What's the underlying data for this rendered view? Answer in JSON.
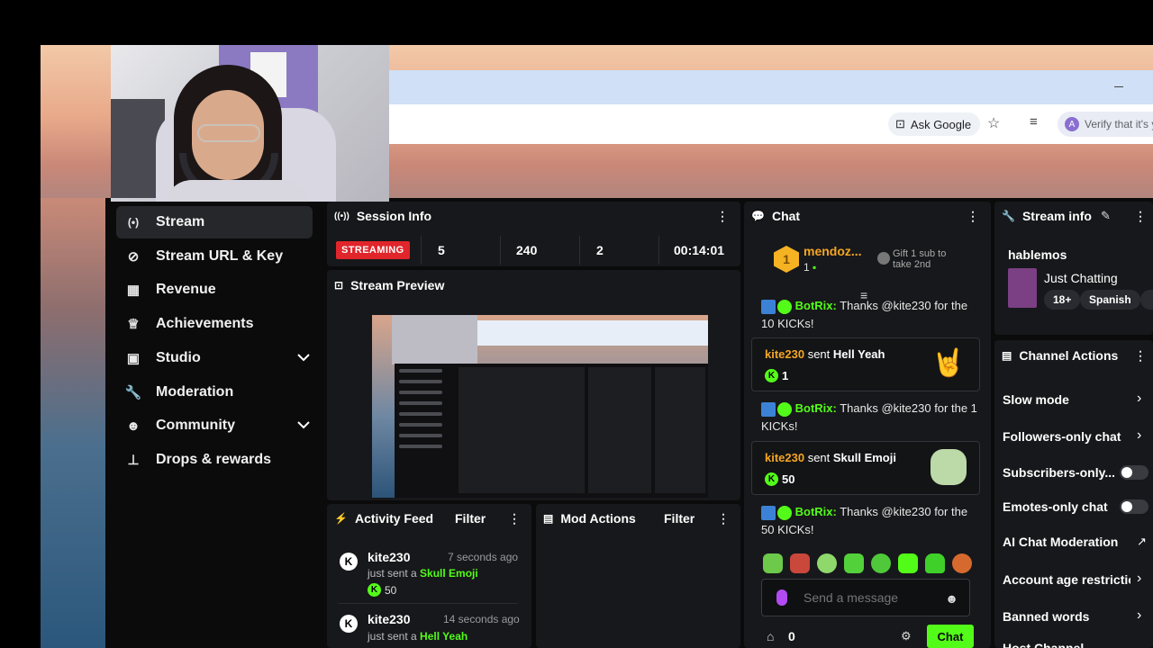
{
  "browser": {
    "ask_google": "Ask Google",
    "verify_text": "Verify that it's y",
    "verify_avatar": "A"
  },
  "sidebar": {
    "items": [
      {
        "label": "Stream",
        "icon": "broadcast-icon",
        "glyph": "(•)"
      },
      {
        "label": "Stream URL & Key",
        "icon": "link-icon",
        "glyph": "🔗"
      },
      {
        "label": "Revenue",
        "icon": "chart-icon",
        "glyph": "▦"
      },
      {
        "label": "Achievements",
        "icon": "trophy-icon",
        "glyph": "🏆"
      },
      {
        "label": "Studio",
        "icon": "studio-icon",
        "glyph": "▣"
      },
      {
        "label": "Moderation",
        "icon": "wrench-icon",
        "glyph": "🔧"
      },
      {
        "label": "Community",
        "icon": "users-icon",
        "glyph": "👥"
      },
      {
        "label": "Drops & rewards",
        "icon": "drops-icon",
        "glyph": "⏇"
      }
    ]
  },
  "session_info": {
    "title": "Session Info",
    "status": "STREAMING",
    "viewers": "5",
    "followers": "240",
    "subs": "2",
    "uptime": "00:14:01"
  },
  "stream_preview": {
    "title": "Stream Preview"
  },
  "activity_feed": {
    "title": "Activity Feed",
    "filter": "Filter",
    "items": [
      {
        "user": "kite230",
        "time": "7 seconds ago",
        "prefix": "just sent a",
        "gift": "Skull Emoji",
        "amount": "50"
      },
      {
        "user": "kite230",
        "time": "14 seconds ago",
        "prefix": "just sent a",
        "gift": "Hell Yeah",
        "amount": ""
      }
    ]
  },
  "mod_actions": {
    "title": "Mod Actions",
    "filter": "Filter"
  },
  "chat": {
    "title": "Chat",
    "top_user": "mendoz...",
    "top_user_count": "1",
    "gift_sub_text": "Gift 1 sub to take 2nd",
    "messages": [
      {
        "type": "bot",
        "user": "BotRix:",
        "text": " Thanks @kite230 for the 10 KICKs!"
      },
      {
        "type": "gift",
        "user": "kite230",
        "verb": " sent ",
        "item": "Hell Yeah",
        "amount": "1"
      },
      {
        "type": "bot",
        "user": "BotRix:",
        "text": " Thanks @kite230 for the 1 KICKs!"
      },
      {
        "type": "gift",
        "user": "kite230",
        "verb": " sent ",
        "item": "Skull Emoji",
        "amount": "50"
      },
      {
        "type": "bot",
        "user": "BotRix:",
        "text": " Thanks @kite230 for the 50 KICKs!"
      }
    ],
    "input_placeholder": "Send a message",
    "points": "0",
    "send_label": "Chat"
  },
  "stream_info": {
    "title": "Stream info",
    "stream_title": "hablemos",
    "category": "Just Chatting",
    "tags": [
      "18+",
      "Spanish"
    ]
  },
  "channel_actions": {
    "title": "Channel Actions",
    "items": [
      {
        "label": "Slow mode",
        "control": "chevron"
      },
      {
        "label": "Followers-only chat",
        "control": "chevron"
      },
      {
        "label": "Subscribers-only...",
        "control": "toggle"
      },
      {
        "label": "Emotes-only chat",
        "control": "toggle"
      },
      {
        "label": "AI Chat Moderation",
        "control": "external"
      },
      {
        "label": "Account age restrictio",
        "control": "chevron"
      },
      {
        "label": "Banned words",
        "control": "chevron"
      },
      {
        "label": "Host Channel",
        "control": "none"
      }
    ]
  },
  "colors": {
    "kick_green": "#53fc18",
    "streaming_red": "#e0252b",
    "panel_bg": "#17181b",
    "page_bg": "#0b0b0c"
  }
}
